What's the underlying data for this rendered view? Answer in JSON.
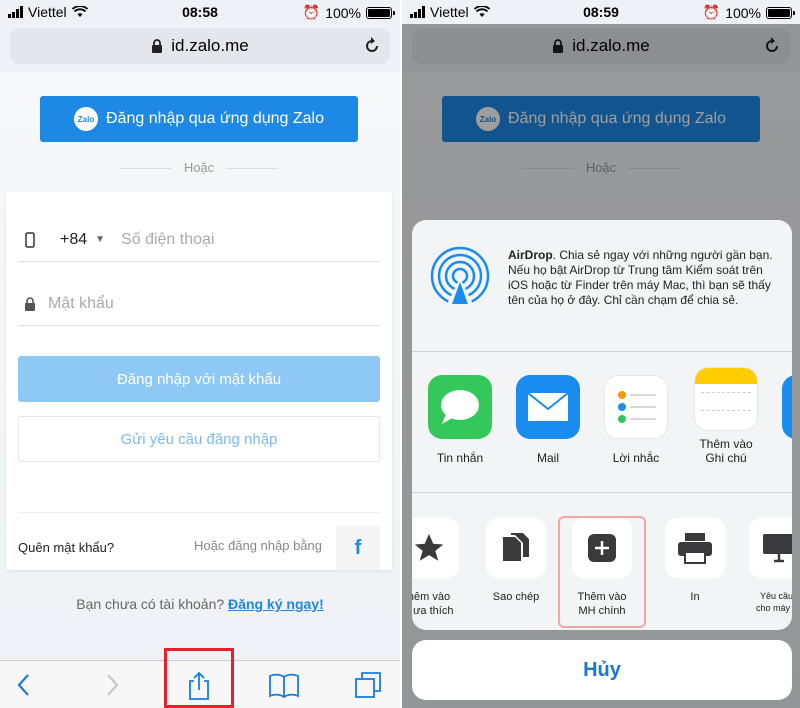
{
  "left": {
    "status": {
      "carrier": "Viettel",
      "time": "08:58",
      "battery": "100%"
    },
    "url": "id.zalo.me",
    "zalo_logo": "Zalo",
    "zalo_button": "Đăng nhập qua ứng dụng Zalo",
    "or_text": "Hoặc",
    "country_code": "+84",
    "phone_placeholder": "Số điện thoại",
    "password_placeholder": "Mật khẩu",
    "login_password_button": "Đăng nhập với mật khẩu",
    "request_login_button": "Gửi yêu cầu đăng nhập",
    "forgot_password": "Quên mật khẩu?",
    "alt_login": "Hoặc đăng nhập bằng",
    "facebook_letter": "f",
    "no_account": "Bạn chưa có tài khoản?",
    "signup_link": "Đăng ký ngay!"
  },
  "right": {
    "status": {
      "carrier": "Viettel",
      "time": "08:59",
      "battery": "100%"
    },
    "url": "id.zalo.me",
    "zalo_button": "Đăng nhập qua ứng dụng Zalo",
    "or_text": "Hoặc",
    "airdrop_title": "AirDrop",
    "airdrop_text": ". Chia sẻ ngay với những người gần bạn. Nếu họ bật AirDrop từ Trung tâm Kiểm soát trên iOS hoặc từ Finder trên máy Mac, thì bạn sẽ thấy tên của họ ở đây. Chỉ cần chạm để chia sẻ.",
    "apps": [
      {
        "label": "Tin nhắn",
        "icon": "messages-icon",
        "color": "#34c759"
      },
      {
        "label": "Mail",
        "icon": "mail-icon",
        "color": "#1a8cf0"
      },
      {
        "label": "Lời nhắc",
        "icon": "reminders-icon",
        "color": "#ffffff"
      },
      {
        "label": "Thêm vào Ghi chú",
        "icon": "notes-icon",
        "color": "#ffffff"
      }
    ],
    "actions": [
      {
        "label": "hêm vào\nc ưa thích",
        "icon": "star-icon"
      },
      {
        "label": "Sao chép",
        "icon": "copy-icon"
      },
      {
        "label": "Thêm vào\nMH chính",
        "icon": "add-home-icon"
      },
      {
        "label": "In",
        "icon": "printer-icon"
      },
      {
        "label": "Yêu cầu t\ncho máy ch",
        "icon": "desktop-icon"
      }
    ],
    "cancel": "Hủy"
  }
}
